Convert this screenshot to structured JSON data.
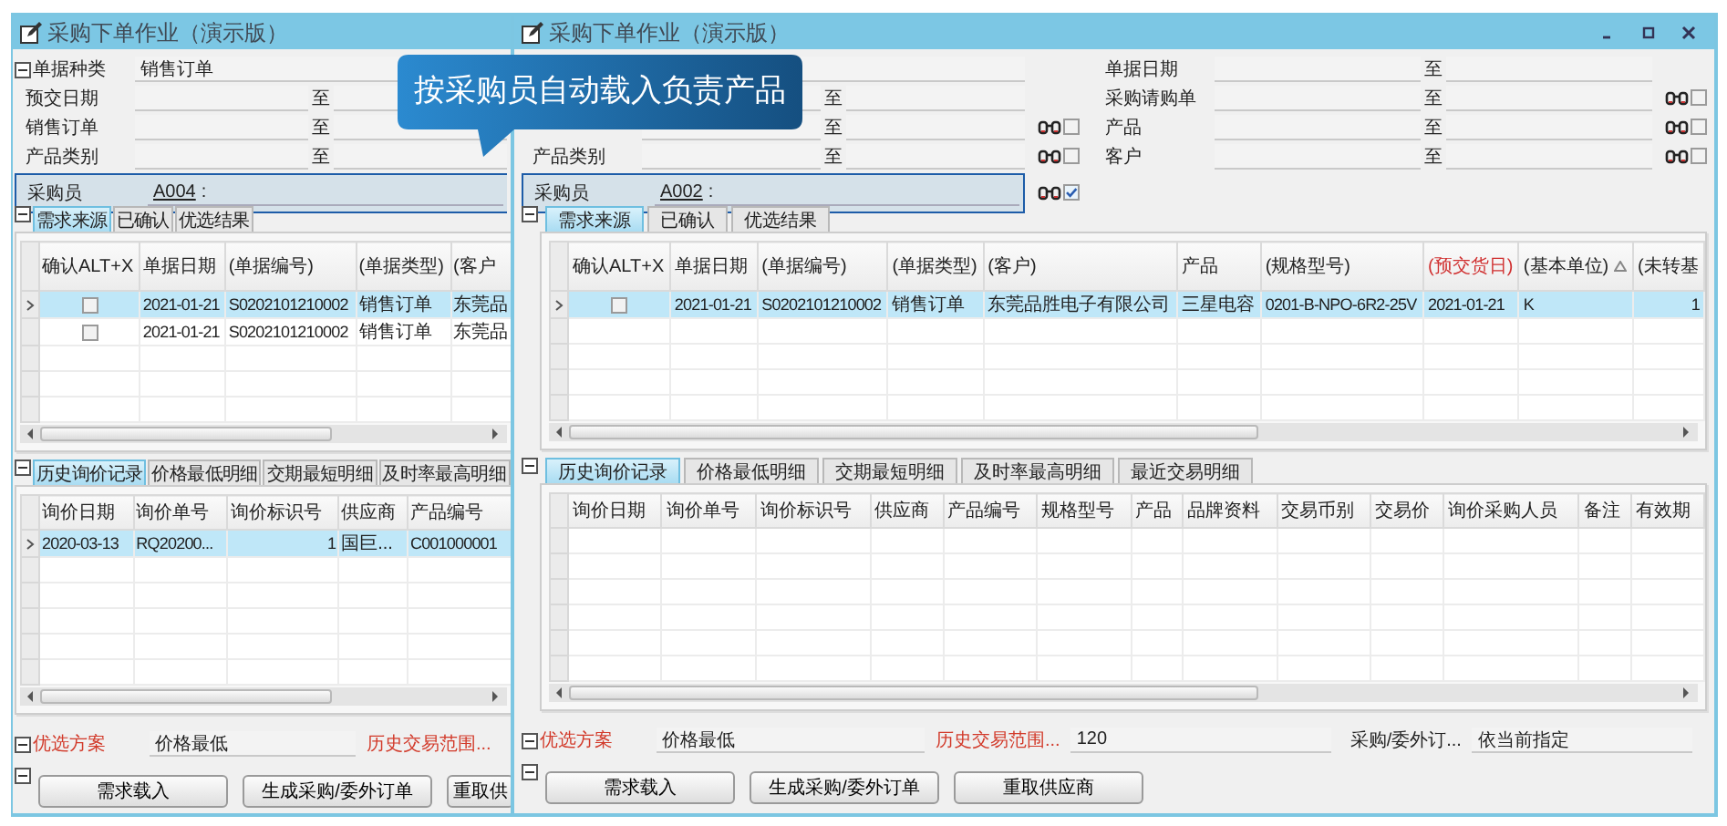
{
  "back_window": {
    "title": "采购下单作业（演示版）",
    "filter_groups": [
      {
        "rows": [
          {
            "kind": "single",
            "label": "单据种类",
            "value": "销售订单",
            "collapse": true
          },
          {
            "kind": "range",
            "label": "预交日期",
            "to": "至"
          },
          {
            "kind": "range",
            "label": "销售订单",
            "to": "至"
          },
          {
            "kind": "range",
            "label": "产品类别",
            "to": "至"
          },
          {
            "kind": "buyer",
            "label": "采购员",
            "code": "A004",
            "separator": ":"
          }
        ]
      }
    ],
    "demand_tabs": [
      {
        "label": "需求来源",
        "selected": true
      },
      {
        "label": "已确认",
        "selected": false
      },
      {
        "label": "优选结果",
        "selected": false
      }
    ],
    "demand_grid": {
      "columns": [
        {
          "label": "确认ALT+X",
          "kind": "check"
        },
        {
          "label": "单据日期"
        },
        {
          "label": "(单据编号)"
        },
        {
          "label": "(单据类型)"
        },
        {
          "label": "(客户"
        }
      ],
      "rows": [
        {
          "selected": true,
          "checked": false,
          "cells": [
            "",
            "2021-01-21",
            "S0202101210002",
            "销售订单",
            "东莞品"
          ]
        },
        {
          "selected": false,
          "checked": false,
          "cells": [
            "",
            "2021-01-21",
            "S0202101210002",
            "销售订单",
            "东莞品"
          ]
        }
      ]
    },
    "history_tabs": [
      {
        "label": "历史询价记录",
        "selected": true
      },
      {
        "label": "价格最低明细",
        "selected": false
      },
      {
        "label": "交期最短明细",
        "selected": false
      },
      {
        "label": "及时率最高明细",
        "selected": false
      }
    ],
    "history_grid": {
      "columns": [
        {
          "label": "询价日期"
        },
        {
          "label": "询价单号"
        },
        {
          "label": "询价标识号",
          "numeric": true
        },
        {
          "label": "供应商"
        },
        {
          "label": "产品编号"
        }
      ],
      "rows": [
        {
          "selected": true,
          "cells": [
            "2020-03-13",
            "RQ20200...",
            "1",
            "国巨...",
            "C001000001"
          ]
        }
      ]
    },
    "preference": {
      "label": "优选方案",
      "value": "价格最低",
      "range_label": "历史交易范围..."
    },
    "buttons": [
      "需求载入",
      "生成采购/委外订单",
      "重取供"
    ]
  },
  "front_window": {
    "title": "采购下单作业（演示版）",
    "window_controls": true,
    "filter_groups": [
      {
        "rows": [
          {
            "kind": "single"
          },
          {
            "kind": "range",
            "to": "至"
          },
          {
            "kind": "range",
            "to": "至",
            "lookup": true,
            "checked": false
          },
          {
            "kind": "range",
            "label": "产品类别",
            "to": "至",
            "lookup": true,
            "checked": false
          },
          {
            "kind": "buyer",
            "label": "采购员",
            "code": "A002",
            "separator": ":",
            "lookup": true,
            "checked": true
          }
        ]
      },
      {
        "rows": [
          {
            "kind": "range",
            "label": "单据日期",
            "to": "至"
          },
          {
            "kind": "range",
            "label": "采购请购单",
            "to": "至",
            "lookup": true,
            "checked": false
          },
          {
            "kind": "range",
            "label": "产品",
            "to": "至",
            "lookup": true,
            "checked": false
          },
          {
            "kind": "range",
            "label": "客户",
            "to": "至",
            "lookup": true,
            "checked": false
          }
        ]
      }
    ],
    "demand_tabs": [
      {
        "label": "需求来源",
        "selected": true
      },
      {
        "label": "已确认",
        "selected": false
      },
      {
        "label": "优选结果",
        "selected": false
      }
    ],
    "demand_grid": {
      "columns": [
        {
          "label": "确认ALT+X",
          "kind": "check"
        },
        {
          "label": "单据日期"
        },
        {
          "label": "(单据编号)"
        },
        {
          "label": "(单据类型)"
        },
        {
          "label": "(客户)"
        },
        {
          "label": "产品"
        },
        {
          "label": "(规格型号)"
        },
        {
          "label": "(预交货日)",
          "emphasized": true
        },
        {
          "label": "(基本单位)",
          "sorted": true
        },
        {
          "label": "(未转基",
          "numeric": true
        }
      ],
      "rows": [
        {
          "selected": true,
          "checked": false,
          "cells": [
            "",
            "2021-01-21",
            "S0202101210002",
            "销售订单",
            "东莞品胜电子有限公司",
            "三星电容",
            "0201-B-NPO-6R2-25V",
            "2021-01-21",
            "K",
            "1"
          ]
        }
      ]
    },
    "history_tabs": [
      {
        "label": "历史询价记录",
        "selected": true
      },
      {
        "label": "价格最低明细",
        "selected": false
      },
      {
        "label": "交期最短明细",
        "selected": false
      },
      {
        "label": "及时率最高明细",
        "selected": false
      },
      {
        "label": "最近交易明细",
        "selected": false
      }
    ],
    "history_grid": {
      "columns": [
        {
          "label": "询价日期"
        },
        {
          "label": "询价单号"
        },
        {
          "label": "询价标识号"
        },
        {
          "label": "供应商"
        },
        {
          "label": "产品编号"
        },
        {
          "label": "规格型号"
        },
        {
          "label": "产品"
        },
        {
          "label": "品牌资料"
        },
        {
          "label": "交易币别"
        },
        {
          "label": "交易价"
        },
        {
          "label": "询价采购人员"
        },
        {
          "label": "备注"
        },
        {
          "label": "有效期"
        }
      ]
    },
    "preference": {
      "label": "优选方案",
      "value": "价格最低",
      "range_label": "历史交易范围...",
      "range_value": "120",
      "order_label": "采购/委外订...",
      "order_value": "依当前指定"
    },
    "buttons": [
      "需求载入",
      "生成采购/委外订单",
      "重取供应商"
    ]
  },
  "callout": {
    "text": "按采购员自动载入负责产品"
  }
}
